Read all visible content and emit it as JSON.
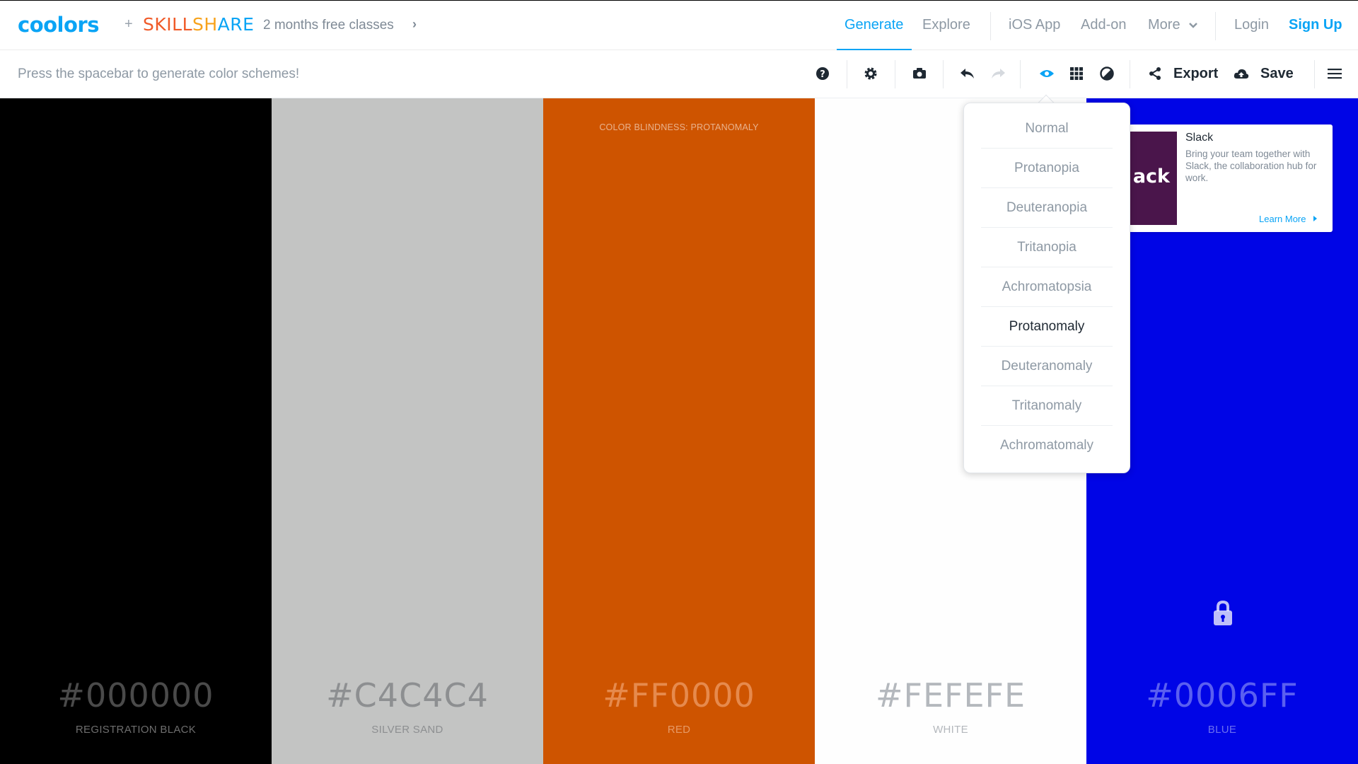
{
  "nav": {
    "logo": "coolors",
    "plus": "+",
    "skillshare": {
      "skill": "SKILL",
      "sh": "SH",
      "are": "ARE"
    },
    "promo": "2 months free classes",
    "promo_chevron": "›",
    "links": {
      "generate": "Generate",
      "explore": "Explore",
      "ios": "iOS App",
      "addon": "Add-on",
      "more": "More",
      "login": "Login",
      "signup": "Sign Up"
    }
  },
  "toolbar": {
    "hint": "Press the spacebar to generate color schemes!",
    "export": "Export",
    "save": "Save",
    "icons": [
      "help-icon",
      "gear-icon",
      "camera-icon",
      "undo-icon",
      "redo-icon",
      "eye-icon",
      "grid-icon",
      "contrast-icon",
      "share-icon",
      "cloud-upload-icon",
      "menu-icon"
    ]
  },
  "palette": {
    "colorblind_label": "COLOR BLINDNESS: PROTANOMALY",
    "swatches": [
      {
        "hex": "#000000",
        "name": "REGISTRATION BLACK",
        "bg": "#000000",
        "text_color": "#4a4a4a",
        "name_color": "#6e6e6e"
      },
      {
        "hex": "#C4C4C4",
        "name": "SILVER SAND",
        "bg": "#c3c4c3",
        "text_color": "#8d8f91",
        "name_color": "#8d8f91"
      },
      {
        "hex": "#FF0000",
        "name": "RED",
        "bg": "#ce5400",
        "text_color": "#e68a4d",
        "name_color": "#e69a66"
      },
      {
        "hex": "#FEFEFE",
        "name": "WHITE",
        "bg": "#fefefe",
        "text_color": "#b4b8bd",
        "name_color": "#b4b8bd"
      },
      {
        "hex": "#0006FF",
        "name": "BLUE",
        "bg": "#0005e6",
        "text_color": "#5a5ff0",
        "name_color": "#6a6ff0"
      }
    ]
  },
  "colorblind_menu": {
    "items": [
      "Normal",
      "Protanopia",
      "Deuteranopia",
      "Tritanopia",
      "Achromatopsia",
      "Protanomaly",
      "Deuteranomaly",
      "Tritanomaly",
      "Achromatomaly"
    ],
    "selected": "Protanomaly"
  },
  "ad": {
    "image_text": "ack",
    "title": "Slack",
    "body": "Bring your team together with Slack, the collaboration hub for work.",
    "link": "Learn More"
  },
  "colors": {
    "accent": "#0aa4f5",
    "slack": "#4a154b"
  }
}
